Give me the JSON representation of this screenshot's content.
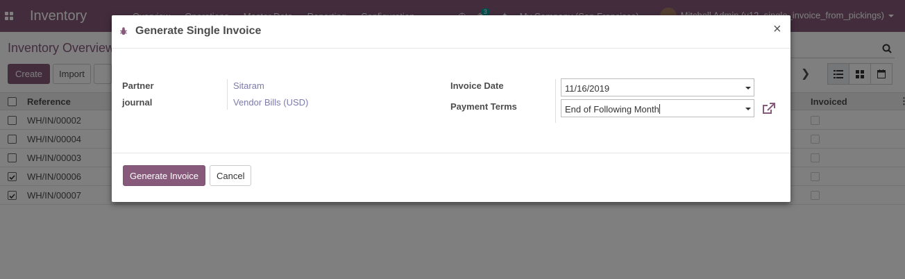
{
  "navbar": {
    "brand": "Inventory",
    "menu": [
      "Overview",
      "Operations",
      "Master Data",
      "Reporting",
      "Configuration"
    ],
    "messages_count": "3",
    "company": "My Company (San Francisco)",
    "user": "Mitchell Admin (v12_single_invoice_from_pickings)"
  },
  "control_panel": {
    "breadcrumb": "Inventory Overview",
    "create_label": "Create",
    "import_label": "Import"
  },
  "list": {
    "columns": {
      "reference": "Reference",
      "invoiced": "Invoiced"
    },
    "rows": [
      {
        "ref": "WH/IN/00002",
        "checked": false
      },
      {
        "ref": "WH/IN/00004",
        "checked": false
      },
      {
        "ref": "WH/IN/00003",
        "checked": false
      },
      {
        "ref": "WH/IN/00006",
        "checked": true
      },
      {
        "ref": "WH/IN/00007",
        "checked": true
      }
    ]
  },
  "dialog": {
    "title": "Generate Single Invoice",
    "partner_label": "Partner",
    "partner_value": "Sitaram",
    "journal_label": "journal",
    "journal_value": "Vendor Bills (USD)",
    "invoice_date_label": "Invoice Date",
    "invoice_date_value": "11/16/2019",
    "payment_terms_label": "Payment Terms",
    "payment_terms_value": "End of Following Month",
    "generate_label": "Generate Invoice",
    "cancel_label": "Cancel",
    "close_symbol": "×"
  },
  "colors": {
    "brand": "#875a7b",
    "link": "#7c7bad"
  }
}
